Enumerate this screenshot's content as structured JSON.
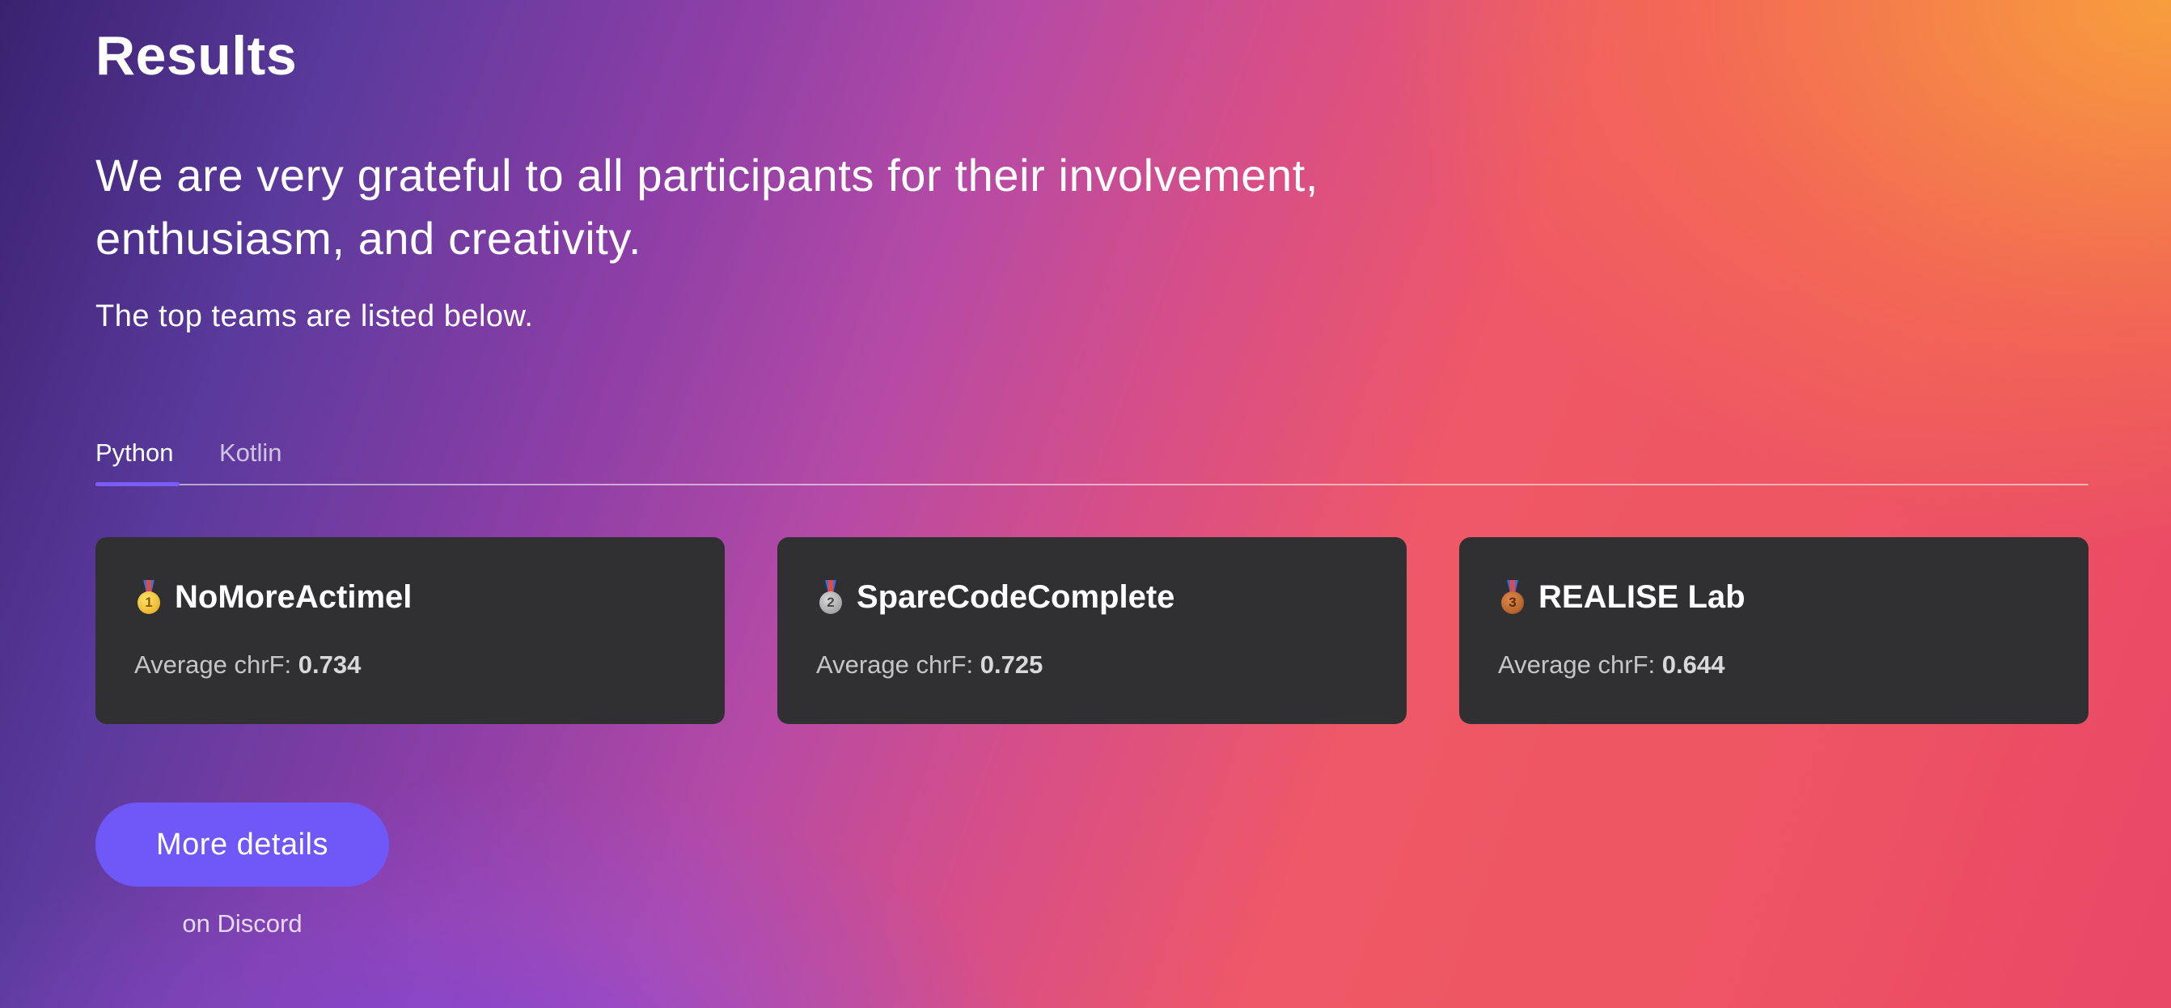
{
  "header": {
    "title": "Results"
  },
  "intro": {
    "lead": "We are very grateful to all participants for their involvement, enthusiasm, and creativity.",
    "sub": "The top teams are listed below."
  },
  "tabs": [
    {
      "label": "Python",
      "active": true
    },
    {
      "label": "Kotlin",
      "active": false
    }
  ],
  "leaderboard": {
    "metric_label": "Average chrF:",
    "entries": [
      {
        "rank": "1",
        "medal": "gold-medal-icon",
        "team": "NoMoreActimel",
        "score": "0.734"
      },
      {
        "rank": "2",
        "medal": "silver-medal-icon",
        "team": "SpareCodeComplete",
        "score": "0.725"
      },
      {
        "rank": "3",
        "medal": "bronze-medal-icon",
        "team": "REALISE Lab",
        "score": "0.644"
      }
    ]
  },
  "cta": {
    "button_label": "More details",
    "note": "on Discord"
  },
  "colors": {
    "card_bg": "#303033",
    "button_bg": "#6f58f7",
    "tab_indicator": "#7b5cf5",
    "gradient_start": "#3a2270",
    "gradient_end": "#f8a33a"
  }
}
